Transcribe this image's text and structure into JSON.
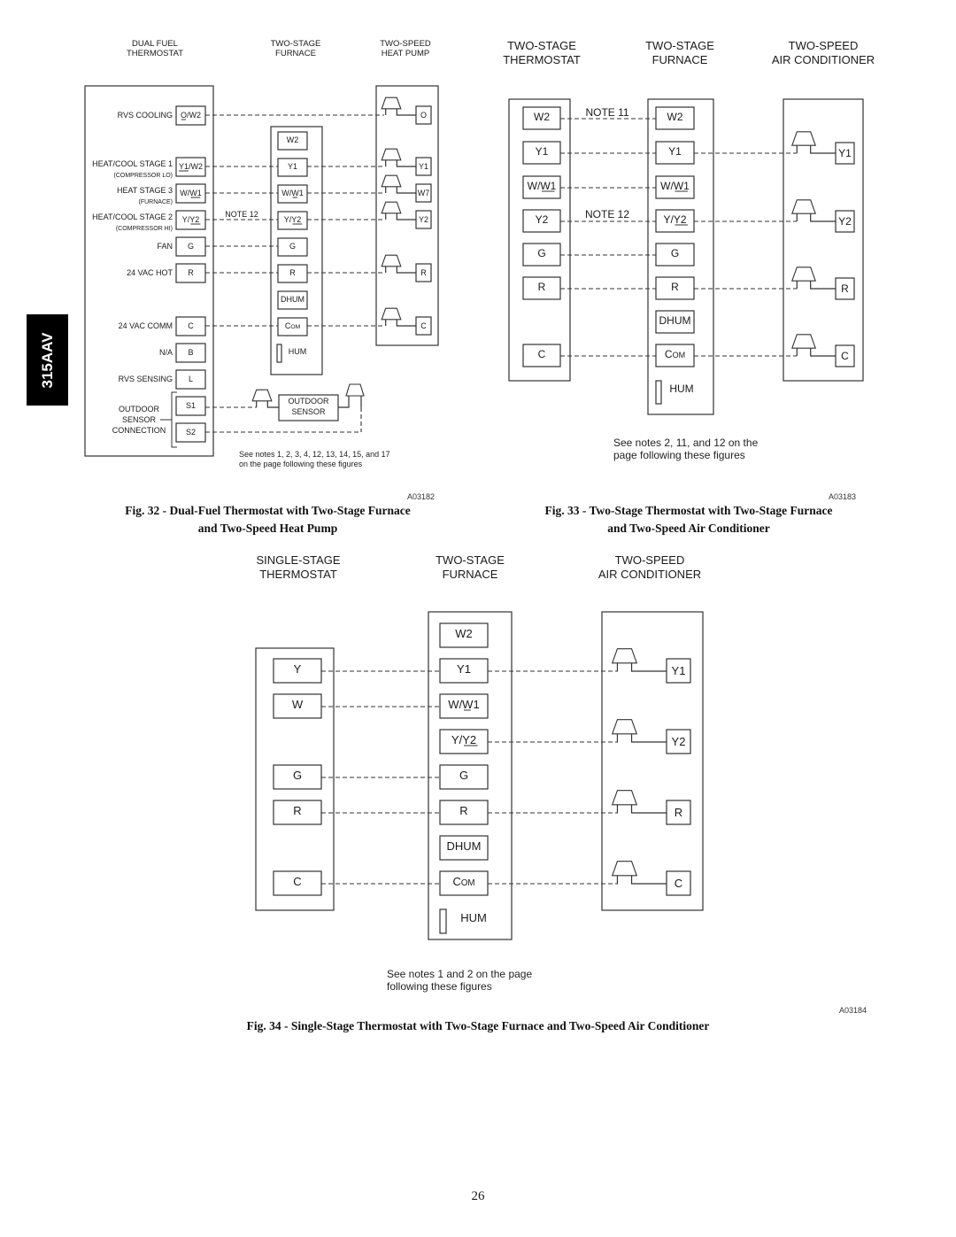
{
  "side_tab": "315AAV",
  "page_number": "26",
  "fig32": {
    "headers": {
      "thermostat": [
        "DUAL FUEL",
        "THERMOSTAT"
      ],
      "furnace": [
        "TWO-STAGE",
        "FURNACE"
      ],
      "heatpump": [
        "TWO-SPEED",
        "HEAT PUMP"
      ]
    },
    "thermostat_terminals": [
      {
        "label": "RVS COOLING",
        "sub": "",
        "terminal": "O/W2",
        "underline": "O"
      },
      {
        "label": "HEAT/COOL STAGE 1",
        "sub": "(COMPRESSOR LO)",
        "terminal": "Y1/W2",
        "underline": "Y1"
      },
      {
        "label": "HEAT STAGE 3",
        "sub": "(FURNACE)",
        "terminal": "W/W1",
        "underline": "W1"
      },
      {
        "label": "HEAT/COOL STAGE 2",
        "sub": "(COMPRESSOR HI)",
        "terminal": "Y/Y2",
        "underline": "Y2"
      },
      {
        "label": "FAN",
        "sub": "",
        "terminal": "G",
        "underline": ""
      },
      {
        "label": "24 VAC HOT",
        "sub": "",
        "terminal": "R",
        "underline": ""
      },
      {
        "label": "24 VAC COMM",
        "sub": "",
        "terminal": "C",
        "underline": ""
      },
      {
        "label": "N/A",
        "sub": "",
        "terminal": "B",
        "underline": ""
      },
      {
        "label": "RVS SENSING",
        "sub": "",
        "terminal": "L",
        "underline": ""
      },
      {
        "label": "",
        "sub": "",
        "terminal": "S1",
        "underline": ""
      },
      {
        "label": "",
        "sub": "",
        "terminal": "S2",
        "underline": ""
      }
    ],
    "outdoor_sensor_label": [
      "OUTDOOR",
      "SENSOR",
      "CONNECTION"
    ],
    "furnace_terminals": [
      "W2",
      "Y1",
      "W/W1",
      "Y/Y2",
      "G",
      "R",
      "DHUM",
      "COM",
      "HUM"
    ],
    "heatpump_terminals": [
      "O",
      "Y1",
      "W7",
      "Y2",
      "R",
      "C"
    ],
    "outdoor_sensor_box": [
      "OUTDOOR",
      "SENSOR"
    ],
    "note12": "NOTE 12",
    "footnote": [
      "See notes 1, 2, 3, 4, 12, 13, 14, 15, and 17",
      "on the page following these figures"
    ],
    "fig_id": "A03182",
    "caption": [
      "Fig. 32 - Dual-Fuel Thermostat with Two-Stage Furnace",
      "and Two-Speed Heat Pump"
    ]
  },
  "fig33": {
    "headers": {
      "thermostat": [
        "TWO-STAGE",
        "THERMOSTAT"
      ],
      "furnace": [
        "TWO-STAGE",
        "FURNACE"
      ],
      "ac": [
        "TWO-SPEED",
        "AIR CONDITIONER"
      ]
    },
    "thermostat_terminals": [
      "W2",
      "Y1",
      "W/W1",
      "Y2",
      "G",
      "R",
      "C"
    ],
    "furnace_terminals": [
      "W2",
      "Y1",
      "W/W1",
      "Y/Y2",
      "G",
      "R",
      "DHUM",
      "COM",
      "HUM"
    ],
    "ac_terminals": [
      "Y1",
      "Y2",
      "R",
      "C"
    ],
    "note11": "NOTE 11",
    "note12": "NOTE 12",
    "footnote": [
      "See notes 2, 11, and 12 on the",
      "page following these figures"
    ],
    "fig_id": "A03183",
    "caption": [
      "Fig. 33 - Two-Stage Thermostat with Two-Stage Furnace",
      "and Two-Speed Air Conditioner"
    ]
  },
  "fig34": {
    "headers": {
      "thermostat": [
        "SINGLE-STAGE",
        "THERMOSTAT"
      ],
      "furnace": [
        "TWO-STAGE",
        "FURNACE"
      ],
      "ac": [
        "TWO-SPEED",
        "AIR CONDITIONER"
      ]
    },
    "thermostat_terminals": [
      "Y",
      "W",
      "G",
      "R",
      "C"
    ],
    "furnace_terminals": [
      "W2",
      "Y1",
      "W/W1",
      "Y/Y2",
      "G",
      "R",
      "DHUM",
      "COM",
      "HUM"
    ],
    "ac_terminals": [
      "Y1",
      "Y2",
      "R",
      "C"
    ],
    "footnote": [
      "See notes 1 and 2 on the page",
      "following these figures"
    ],
    "fig_id": "A03184",
    "caption": "Fig. 34 - Single-Stage Thermostat with Two-Stage Furnace and Two-Speed Air Conditioner"
  }
}
